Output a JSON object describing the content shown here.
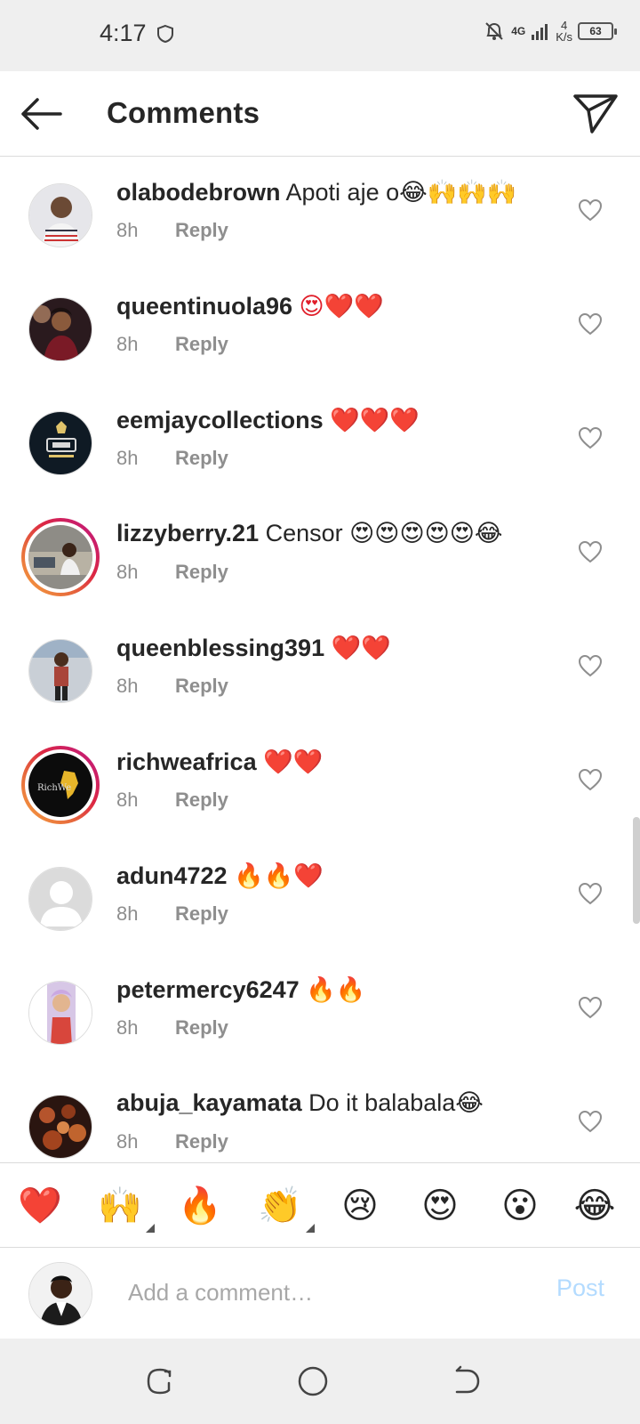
{
  "status_bar": {
    "time": "4:17",
    "network": "4G",
    "speed_value": "4",
    "speed_unit": "K/s",
    "battery": "63"
  },
  "header": {
    "title": "Comments",
    "back_icon": "back-arrow-icon",
    "send_icon": "direct-send-icon"
  },
  "comments": [
    {
      "username": "olabodebrown",
      "text": "Apoti aje o😂🙌🙌🙌",
      "time": "8h",
      "reply_label": "Reply",
      "story_ring": false
    },
    {
      "username": "queentinuola96",
      "text": "😍❤️❤️",
      "time": "8h",
      "reply_label": "Reply",
      "story_ring": false
    },
    {
      "username": "eemjaycollections",
      "text": "❤️❤️❤️",
      "time": "8h",
      "reply_label": "Reply",
      "story_ring": false
    },
    {
      "username": "lizzyberry.21",
      "text": "Censor 😍😍😍😍😍😂",
      "time": "8h",
      "reply_label": "Reply",
      "story_ring": true
    },
    {
      "username": "queenblessing391",
      "text": "❤️❤️",
      "time": "8h",
      "reply_label": "Reply",
      "story_ring": false
    },
    {
      "username": "richweafrica",
      "text": "❤️❤️",
      "time": "8h",
      "reply_label": "Reply",
      "story_ring": true
    },
    {
      "username": "adun4722",
      "text": "🔥🔥❤️",
      "time": "8h",
      "reply_label": "Reply",
      "story_ring": false
    },
    {
      "username": "petermercy6247",
      "text": "🔥🔥",
      "time": "8h",
      "reply_label": "Reply",
      "story_ring": false
    },
    {
      "username": "abuja_kayamata",
      "text": "Do it balabala😂",
      "time": "8h",
      "reply_label": "Reply",
      "story_ring": false
    }
  ],
  "quick_emojis": [
    "❤️",
    "🙌",
    "🔥",
    "👏",
    "😢",
    "😍",
    "😮",
    "😂"
  ],
  "composer": {
    "placeholder": "Add a comment…",
    "post_label": "Post"
  },
  "colors": {
    "ring_start": "#f7a440",
    "ring_end": "#bc1888",
    "post_disabled": "#b3dbff",
    "meta_gray": "#8e8e8e"
  }
}
